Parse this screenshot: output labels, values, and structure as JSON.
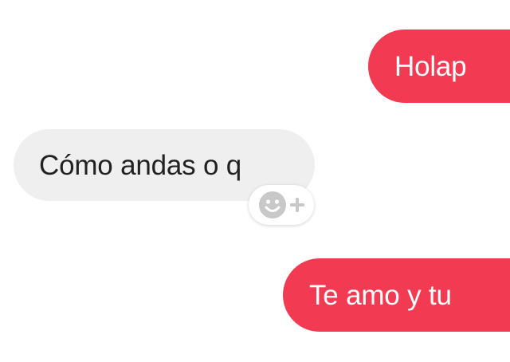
{
  "chat": {
    "messages": [
      {
        "direction": "outgoing",
        "text": "Holap"
      },
      {
        "direction": "incoming",
        "text": "Cómo andas o q"
      },
      {
        "direction": "outgoing",
        "text": "Te amo y tu"
      }
    ],
    "reaction_button": {
      "icon": "smiley-add-reaction-icon"
    }
  },
  "colors": {
    "outgoing_bubble": "#f23b52",
    "incoming_bubble": "#efefef",
    "incoming_text": "#222222",
    "icon_gray": "#c8c8c8"
  }
}
